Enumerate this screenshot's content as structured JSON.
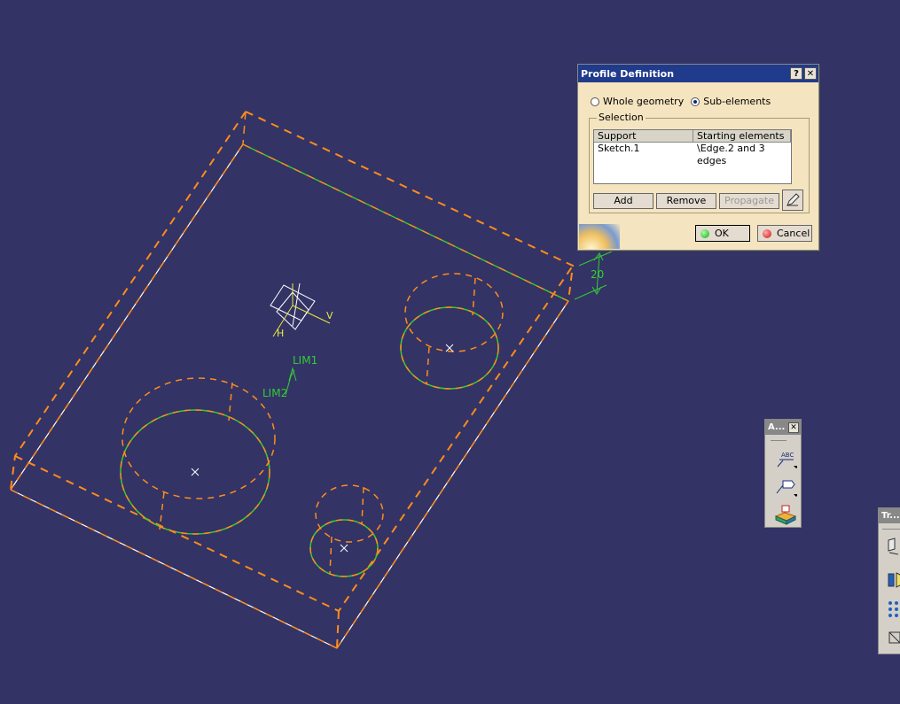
{
  "viewport": {
    "labels": {
      "lim1": "LIM1",
      "lim2": "LIM2",
      "dimension": "20",
      "axis_h": "H",
      "axis_v": "V"
    },
    "colors": {
      "background": "#333366",
      "profile_dashed": "#ff8c1a",
      "selected_edge": "#33cc33",
      "edge_white": "#ffffff",
      "axis_yellow": "#e8e840"
    }
  },
  "dialog": {
    "title": "Profile Definition",
    "help_label": "?",
    "close_label": "✕",
    "radio_whole": "Whole geometry",
    "radio_sub": "Sub-elements",
    "selected_mode": "Sub-elements",
    "group_label": "Selection",
    "table": {
      "headers": [
        "Support",
        "Starting elements"
      ],
      "rows": [
        [
          "Sketch.1",
          "\\Edge.2 and 3 edges"
        ]
      ]
    },
    "buttons": {
      "add": "Add",
      "remove": "Remove",
      "propagate": "Propagate",
      "ok": "OK",
      "cancel": "Cancel"
    }
  },
  "toolbar_annotation": {
    "title": "A...",
    "close_label": "✕",
    "tools": [
      "text-with-leader-icon",
      "flag-note-icon",
      "annotation-plane-icon"
    ],
    "abc_text": "ABC"
  },
  "toolbar_transform": {
    "title": "Tr..."
  }
}
